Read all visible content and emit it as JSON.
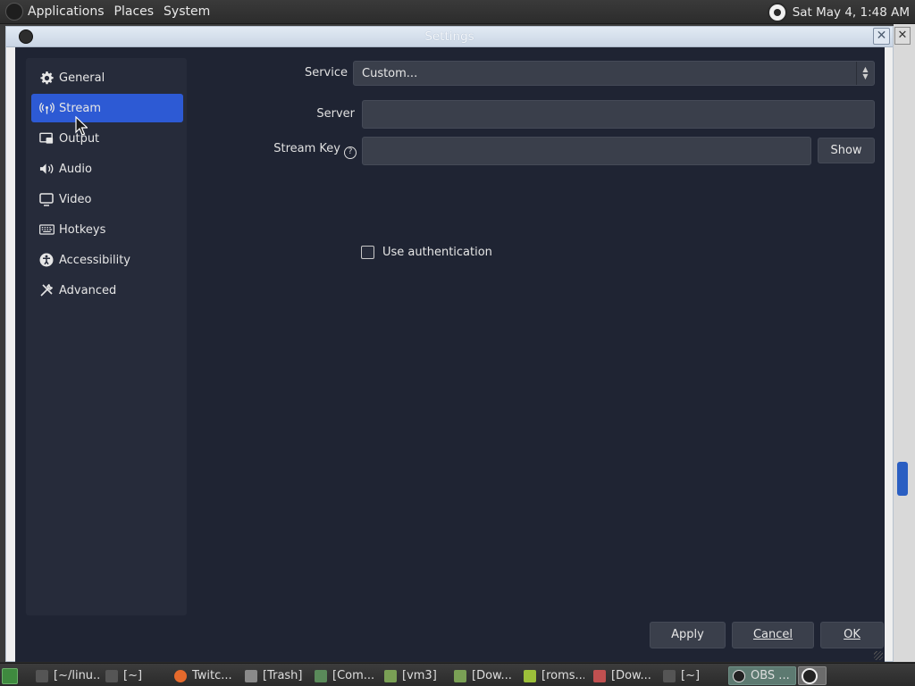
{
  "top_panel": {
    "menus": [
      "Applications",
      "Places",
      "System"
    ],
    "clock": "Sat May 4,  1:48 AM"
  },
  "window": {
    "title": "Settings",
    "close_glyph": "✕"
  },
  "sidebar": {
    "items": [
      {
        "label": "General",
        "icon": "gear-icon",
        "glyph": "⚙",
        "active": false
      },
      {
        "label": "Stream",
        "icon": "antenna-icon",
        "glyph": "((•))",
        "active": true
      },
      {
        "label": "Output",
        "icon": "output-icon",
        "glyph": "▭",
        "active": false
      },
      {
        "label": "Audio",
        "icon": "speaker-icon",
        "glyph": "🔊",
        "active": false
      },
      {
        "label": "Video",
        "icon": "monitor-icon",
        "glyph": "▭",
        "active": false
      },
      {
        "label": "Hotkeys",
        "icon": "keyboard-icon",
        "glyph": "⌨",
        "active": false
      },
      {
        "label": "Accessibility",
        "icon": "accessibility-icon",
        "glyph": "♿",
        "active": false
      },
      {
        "label": "Advanced",
        "icon": "wrench-icon",
        "glyph": "✂",
        "active": false
      }
    ]
  },
  "stream": {
    "service_label": "Service",
    "service_value": "Custom...",
    "server_label": "Server",
    "server_value": "",
    "stream_key_label": "Stream Key",
    "stream_key_help": "?",
    "stream_key_value": "",
    "show_button": "Show",
    "use_auth_label": "Use authentication",
    "use_auth_checked": false
  },
  "buttons": {
    "apply": "Apply",
    "cancel": "Cancel",
    "ok": "OK"
  },
  "taskbar": {
    "items": [
      {
        "label": "[~/linu...",
        "icon": "terminal-icon"
      },
      {
        "label": "[~]",
        "icon": "terminal-icon"
      },
      {
        "label": "Twitc...",
        "icon": "firefox-icon"
      },
      {
        "label": "[Trash]",
        "icon": "trash-icon"
      },
      {
        "label": "[Com...",
        "icon": "computer-icon"
      },
      {
        "label": "[vm3]",
        "icon": "folder-icon"
      },
      {
        "label": "[Dow...",
        "icon": "folder-icon"
      },
      {
        "label": "[roms...",
        "icon": "archive-icon"
      },
      {
        "label": "[Dow...",
        "icon": "app-icon"
      },
      {
        "label": "[~]",
        "icon": "terminal-icon"
      },
      {
        "label": "OBS ...",
        "icon": "obs-icon"
      }
    ]
  },
  "colors": {
    "accent": "#2d5ad4",
    "background": "#1f2433",
    "sidebar": "#262b3a",
    "field": "#3a3f4b"
  }
}
